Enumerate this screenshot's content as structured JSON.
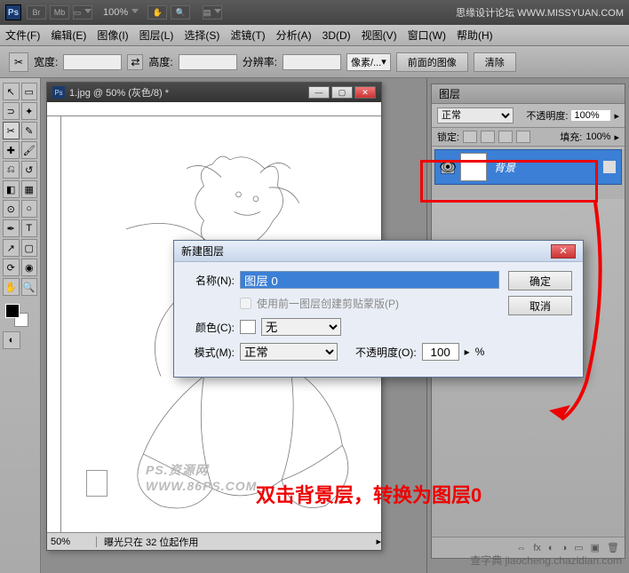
{
  "titlebar": {
    "ps": "Ps",
    "br": "Br",
    "mb": "Mb",
    "zoom": "100%",
    "site": "思缘设计论坛  WWW.MISSYUAN.COM"
  },
  "menu": {
    "file": "文件(F)",
    "edit": "编辑(E)",
    "image": "图像(I)",
    "layer": "图层(L)",
    "select": "选择(S)",
    "filter": "滤镜(T)",
    "analysis": "分析(A)",
    "threed": "3D(D)",
    "view": "视图(V)",
    "window": "窗口(W)",
    "help": "帮助(H)"
  },
  "opt": {
    "width": "宽度:",
    "height": "高度:",
    "res": "分辨率:",
    "pxcombo": "像素/...",
    "front": "前面的图像",
    "clear": "清除"
  },
  "doc": {
    "title": "1.jpg @ 50% (灰色/8) *",
    "zoom": "50%",
    "status": "曝光只在 32 位起作用",
    "watermark": "PS.资源网   WWW.86PS.COM"
  },
  "panel": {
    "tab": "图层",
    "blend": "正常",
    "opacity_label": "不透明度:",
    "opacity_val": "100%",
    "lock_label": "锁定:",
    "fill_label": "填充:",
    "fill_val": "100%",
    "layer_name": "背景",
    "bottom": {
      "link": "⇔",
      "fx": "fx",
      "mask": "◐",
      "adj": "◑",
      "folder": "▭",
      "new": "▣",
      "trash": "🗑"
    }
  },
  "dialog": {
    "title": "新建图层",
    "name_label": "名称(N):",
    "name_value": "图层 0",
    "clip_label": "使用前一图层创建剪贴蒙版(P)",
    "color_label": "颜色(C):",
    "color_value": "无",
    "mode_label": "模式(M):",
    "mode_value": "正常",
    "opacity_label": "不透明度(O):",
    "opacity_value": "100",
    "pct": "%",
    "ok": "确定",
    "cancel": "取消"
  },
  "anno": {
    "text": "双击背景层，转换为图层0"
  },
  "watermark2": "查字典   jiaocheng.chazidian.com"
}
